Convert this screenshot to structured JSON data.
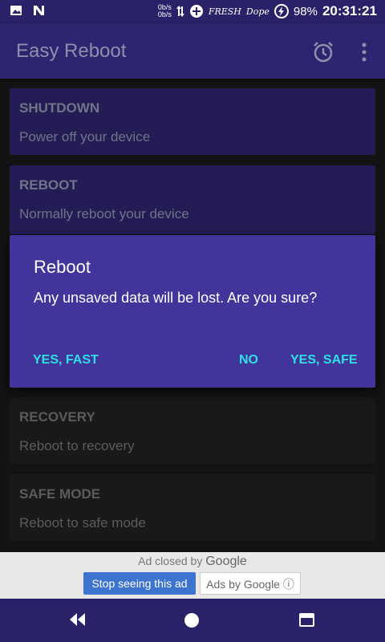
{
  "status_bar": {
    "net_up": "0b/s",
    "net_down": "0b/s",
    "tag1": "FRESH",
    "tag2": "Dope",
    "battery": "98%",
    "time": "20:31:21"
  },
  "app": {
    "title": "Easy Reboot"
  },
  "cards": [
    {
      "title": "SHUTDOWN",
      "desc": "Power off your device"
    },
    {
      "title": "REBOOT",
      "desc": "Normally reboot your device"
    },
    {
      "title": "RECOVERY",
      "desc": "Reboot to recovery"
    },
    {
      "title": "SAFE MODE",
      "desc": "Reboot to safe mode"
    }
  ],
  "dialog": {
    "title": "Reboot",
    "message": "Any unsaved data will be lost. Are you sure?",
    "buttons": {
      "yes_fast": "YES, FAST",
      "no": "NO",
      "yes_safe": "YES, SAFE"
    }
  },
  "ad": {
    "closed_text": "Ad closed by",
    "closed_brand": "Google",
    "stop_label": "Stop seeing this ad",
    "ads_by_label": "Ads by Google ⓘ"
  },
  "colors": {
    "accent": "#2fe0e6",
    "primary": "#2e2570",
    "dialog": "#41349a"
  }
}
